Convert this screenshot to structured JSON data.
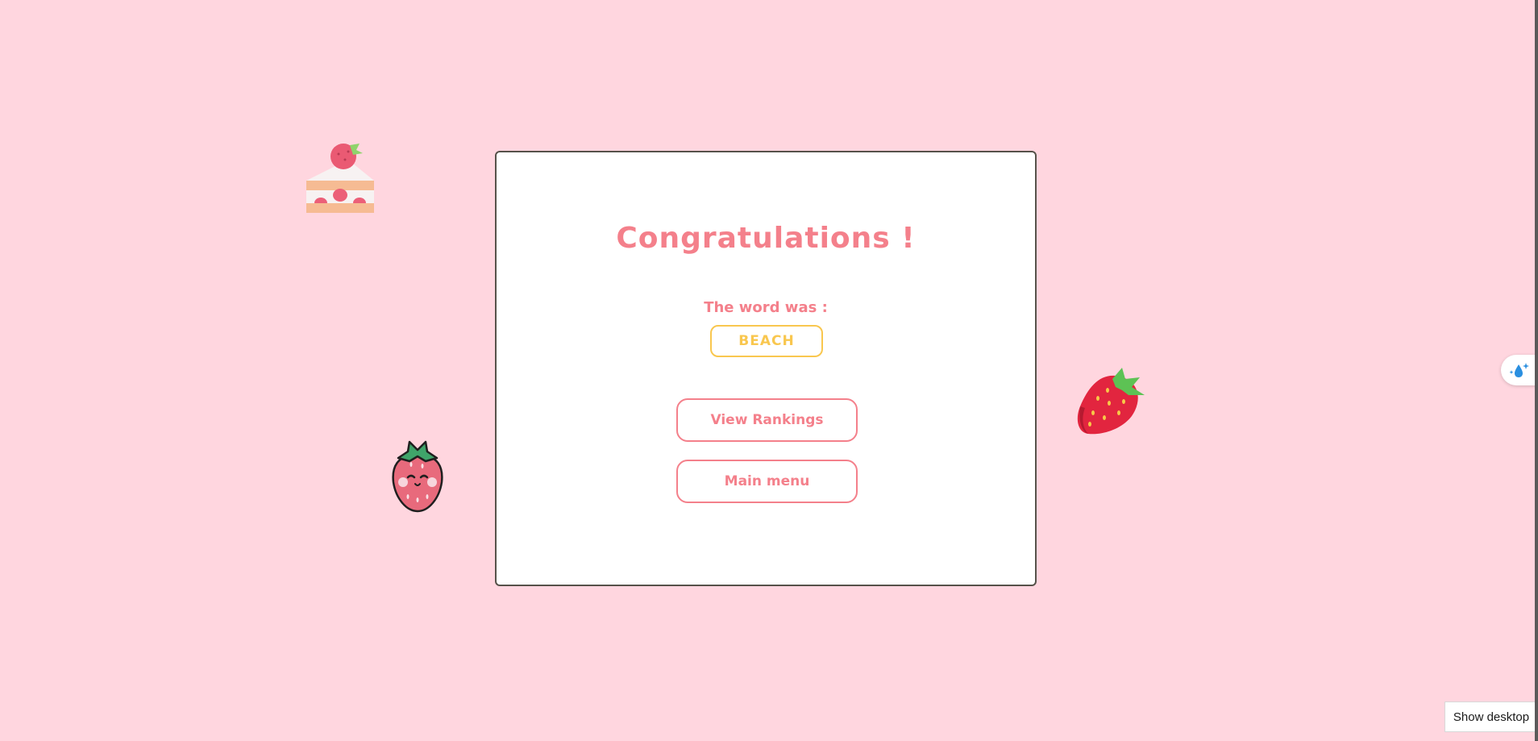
{
  "colors": {
    "background": "#ffd6df",
    "accent_pink": "#f4808b",
    "accent_yellow": "#f9c74f",
    "card_border": "#56524a"
  },
  "result": {
    "title": "Congratulations !",
    "subtitle": "The word was :",
    "word": "BEACH"
  },
  "buttons": {
    "view_rankings": "View Rankings",
    "main_menu": "Main menu"
  },
  "decorations": [
    "strawberry-cake-icon",
    "kawaii-strawberry-icon",
    "strawberry-icon",
    "sparkle-icon"
  ],
  "side_widget": {
    "icon": "water-drop-sparkle-icon"
  },
  "taskbar": {
    "show_desktop": "Show desktop"
  }
}
